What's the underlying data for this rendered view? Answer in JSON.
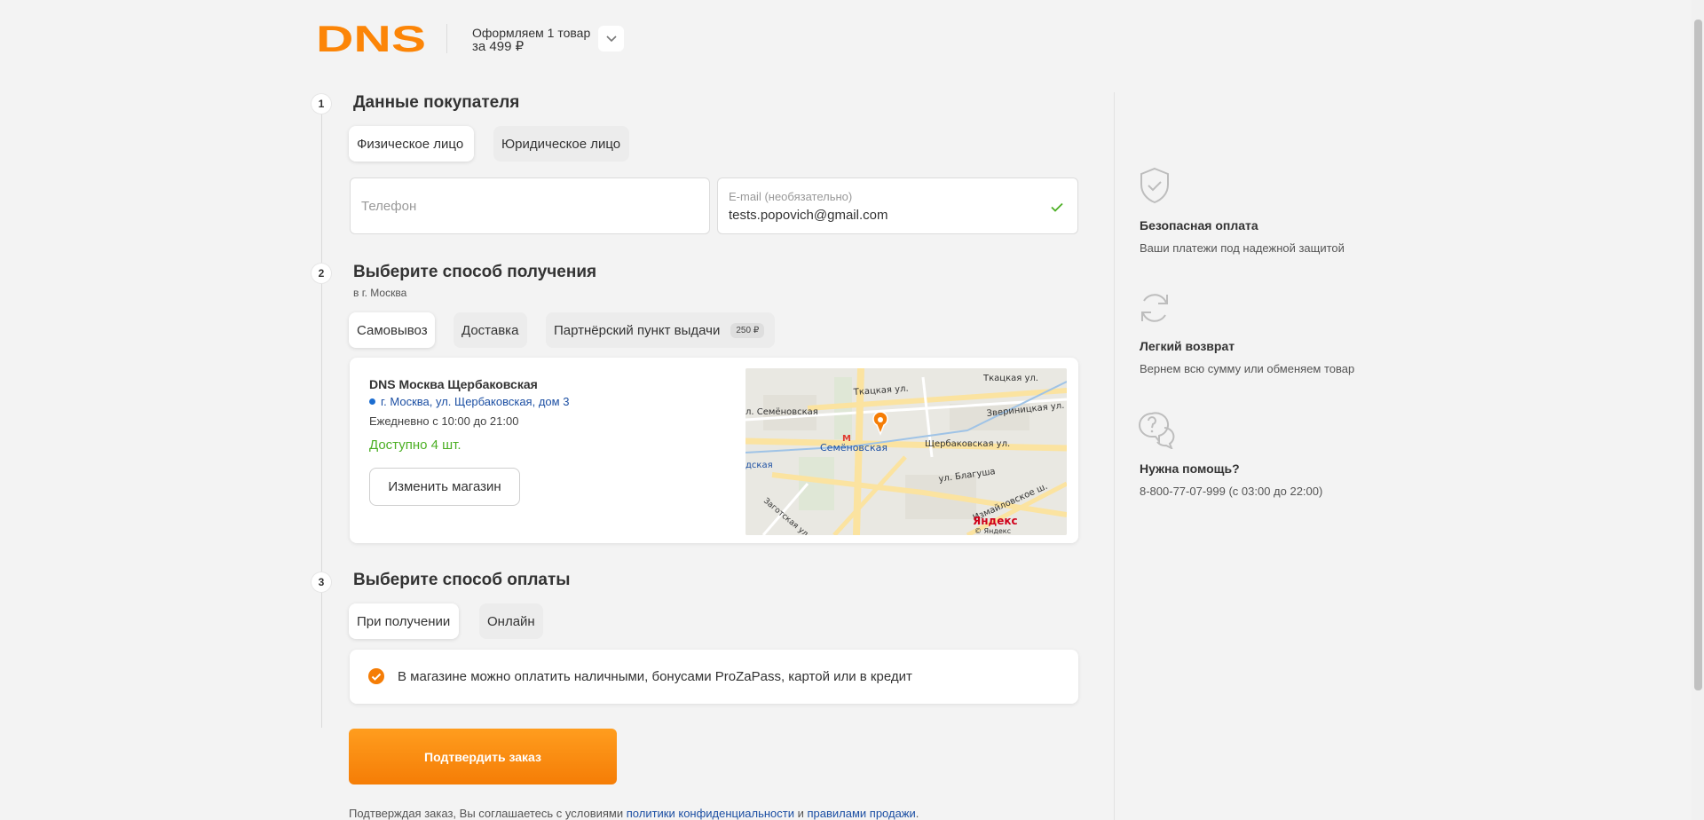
{
  "header": {
    "brand": "DNS",
    "order_line1": "Оформляем 1 товар",
    "order_line2": "за 499 ₽"
  },
  "steps": [
    {
      "num": "1",
      "title": "Данные покупателя"
    },
    {
      "num": "2",
      "title": "Выберите способ получения",
      "subtitle": "в г. Москва"
    },
    {
      "num": "3",
      "title": "Выберите способ оплаты"
    }
  ],
  "buyer": {
    "types": [
      "Физическое лицо",
      "Юридическое лицо"
    ],
    "phone_placeholder": "Телефон",
    "email_label": "E-mail (необязательно)",
    "email_value": "tests.popovich@gmail.com"
  },
  "delivery": {
    "options": [
      "Самовывоз",
      "Доставка",
      "Партнёрский пункт выдачи"
    ],
    "partner_badge": "250 ₽",
    "store": {
      "name": "DNS Москва Щербаковская",
      "address": "г. Москва, ул. Щербаковская, дом 3",
      "hours": "Ежедневно с 10:00 до 21:00",
      "availability": "Доступно 4 шт.",
      "change_label": "Изменить магазин"
    },
    "map": {
      "labels": [
        "Ткацкая ул.",
        "Ткацкая ул.",
        "л. Семёновская",
        "Звериницкая ул.",
        "Семёновская",
        "Щербаковская ул.",
        "дская",
        "ул. Благуша",
        "Измайловское ш.",
        "Заготская ул."
      ],
      "brand": "Яндекс",
      "copyright": "© Яндекс",
      "metro": "М"
    }
  },
  "payment": {
    "options": [
      "При получении",
      "Онлайн"
    ],
    "note": "В магазине можно оплатить наличными, бонусами ProZaPass, картой или в кредит"
  },
  "confirm_label": "Подтвердить заказ",
  "agreement": {
    "prefix": "Подтверждая заказ, Вы соглашаетесь с условиями ",
    "link1": "политики конфиденциальности",
    "middle": " и ",
    "link2": "правилами продажи",
    "suffix": "."
  },
  "benefits": [
    {
      "icon": "shield-check-icon",
      "title": "Безопасная оплата",
      "text": "Ваши платежи под надежной защитой"
    },
    {
      "icon": "refresh-icon",
      "title": "Легкий возврат",
      "text": "Вернем всю сумму или обменяем товар"
    },
    {
      "icon": "chat-question-icon",
      "title": "Нужна помощь?",
      "text": "8-800-77-07-999 (с 03:00 до 22:00)"
    }
  ],
  "colors": {
    "brand": "#fc8507",
    "accent_link": "#1c4fa3",
    "available": "#4caf24"
  }
}
